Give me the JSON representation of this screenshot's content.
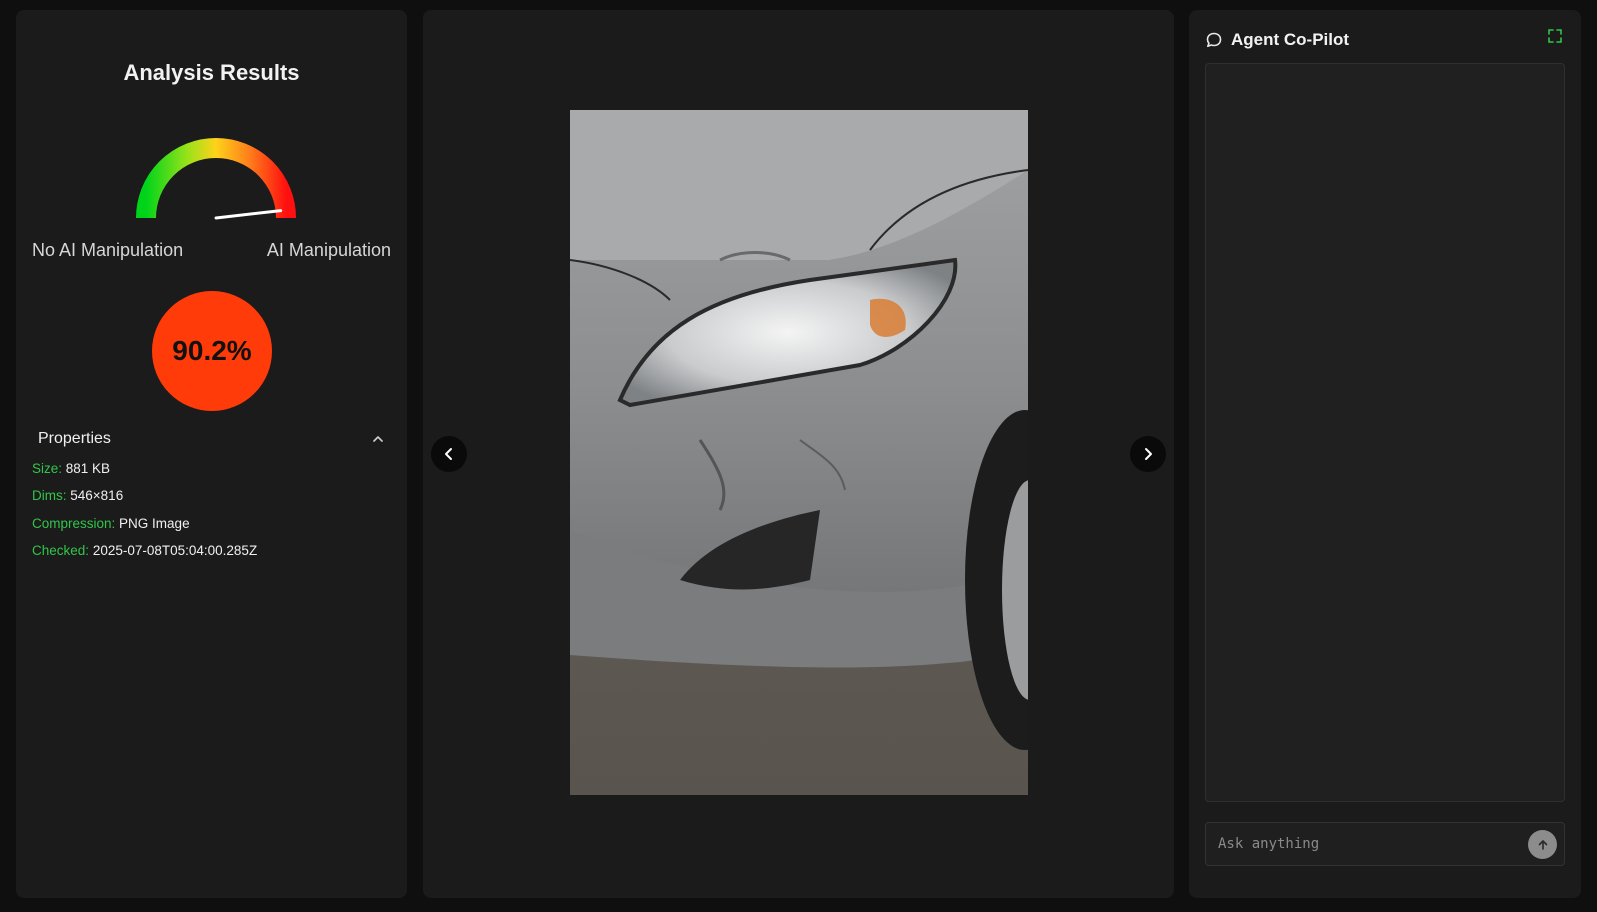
{
  "analysis": {
    "title": "Analysis Results",
    "gauge": {
      "level": 0.9,
      "left_label": "No AI Manipulation",
      "right_label": "AI Manipulation"
    },
    "score": "90.2%",
    "score_color": "#ff3b0a"
  },
  "properties": {
    "header": "Properties",
    "items": [
      {
        "key": "Size:",
        "value": "881 KB"
      },
      {
        "key": "Dims:",
        "value": "546×816"
      },
      {
        "key": "Compression:",
        "value": "PNG Image"
      },
      {
        "key": "Checked:",
        "value": "2025-07-08T05:04:00.285Z"
      }
    ]
  },
  "viewer": {
    "prev_icon": "chevron-left-icon",
    "next_icon": "chevron-right-icon"
  },
  "copilot": {
    "title": "Agent Co-Pilot",
    "chat_icon": "chat-bubble-icon",
    "expand_icon": "expand-icon",
    "input_placeholder": "Ask anything",
    "send_icon": "arrow-up-icon"
  },
  "colors": {
    "accent_green": "#31c54a",
    "background": "#0f0f0f",
    "panel": "#1b1b1b"
  }
}
